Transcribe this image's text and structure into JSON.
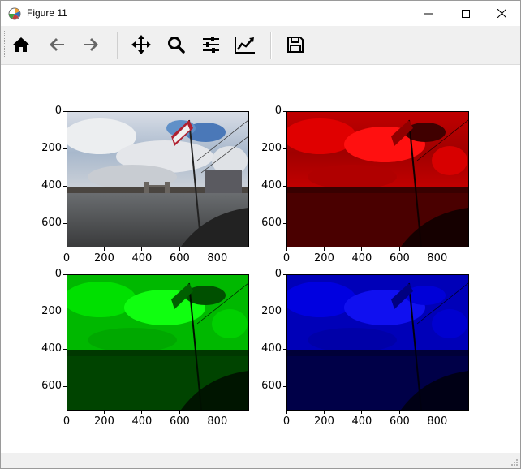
{
  "window": {
    "title": "Figure 11",
    "icon": "matplotlib-icon",
    "controls": [
      "minimize-icon",
      "maximize-icon",
      "close-icon"
    ]
  },
  "toolbar": {
    "buttons": [
      {
        "name": "home-button",
        "icon": "home-icon"
      },
      {
        "name": "back-button",
        "icon": "arrow-left-icon"
      },
      {
        "name": "forward-button",
        "icon": "arrow-right-icon"
      },
      {
        "name": "pan-button",
        "icon": "move-icon"
      },
      {
        "name": "zoom-button",
        "icon": "magnifier-icon"
      },
      {
        "name": "configure-subplots-button",
        "icon": "sliders-icon"
      },
      {
        "name": "edit-axes-button",
        "icon": "chart-line-icon"
      },
      {
        "name": "save-button",
        "icon": "floppy-disk-icon"
      }
    ]
  },
  "figure": {
    "y_ticks": [
      "0",
      "200",
      "400",
      "600"
    ],
    "x_ticks": [
      "0",
      "200",
      "400",
      "600",
      "800"
    ],
    "panels": [
      {
        "name": "panel-original",
        "channel": "rgb",
        "tint": "#ffffff"
      },
      {
        "name": "panel-red-channel",
        "channel": "red",
        "tint": "#ff0000"
      },
      {
        "name": "panel-green-channel",
        "channel": "green",
        "tint": "#00ff00"
      },
      {
        "name": "panel-blue-channel",
        "channel": "blue",
        "tint": "#0000ff"
      }
    ]
  },
  "colors": {
    "toolbar_bg": "#f0f0f0",
    "icon": "#000000",
    "icon_disabled": "#666666"
  }
}
